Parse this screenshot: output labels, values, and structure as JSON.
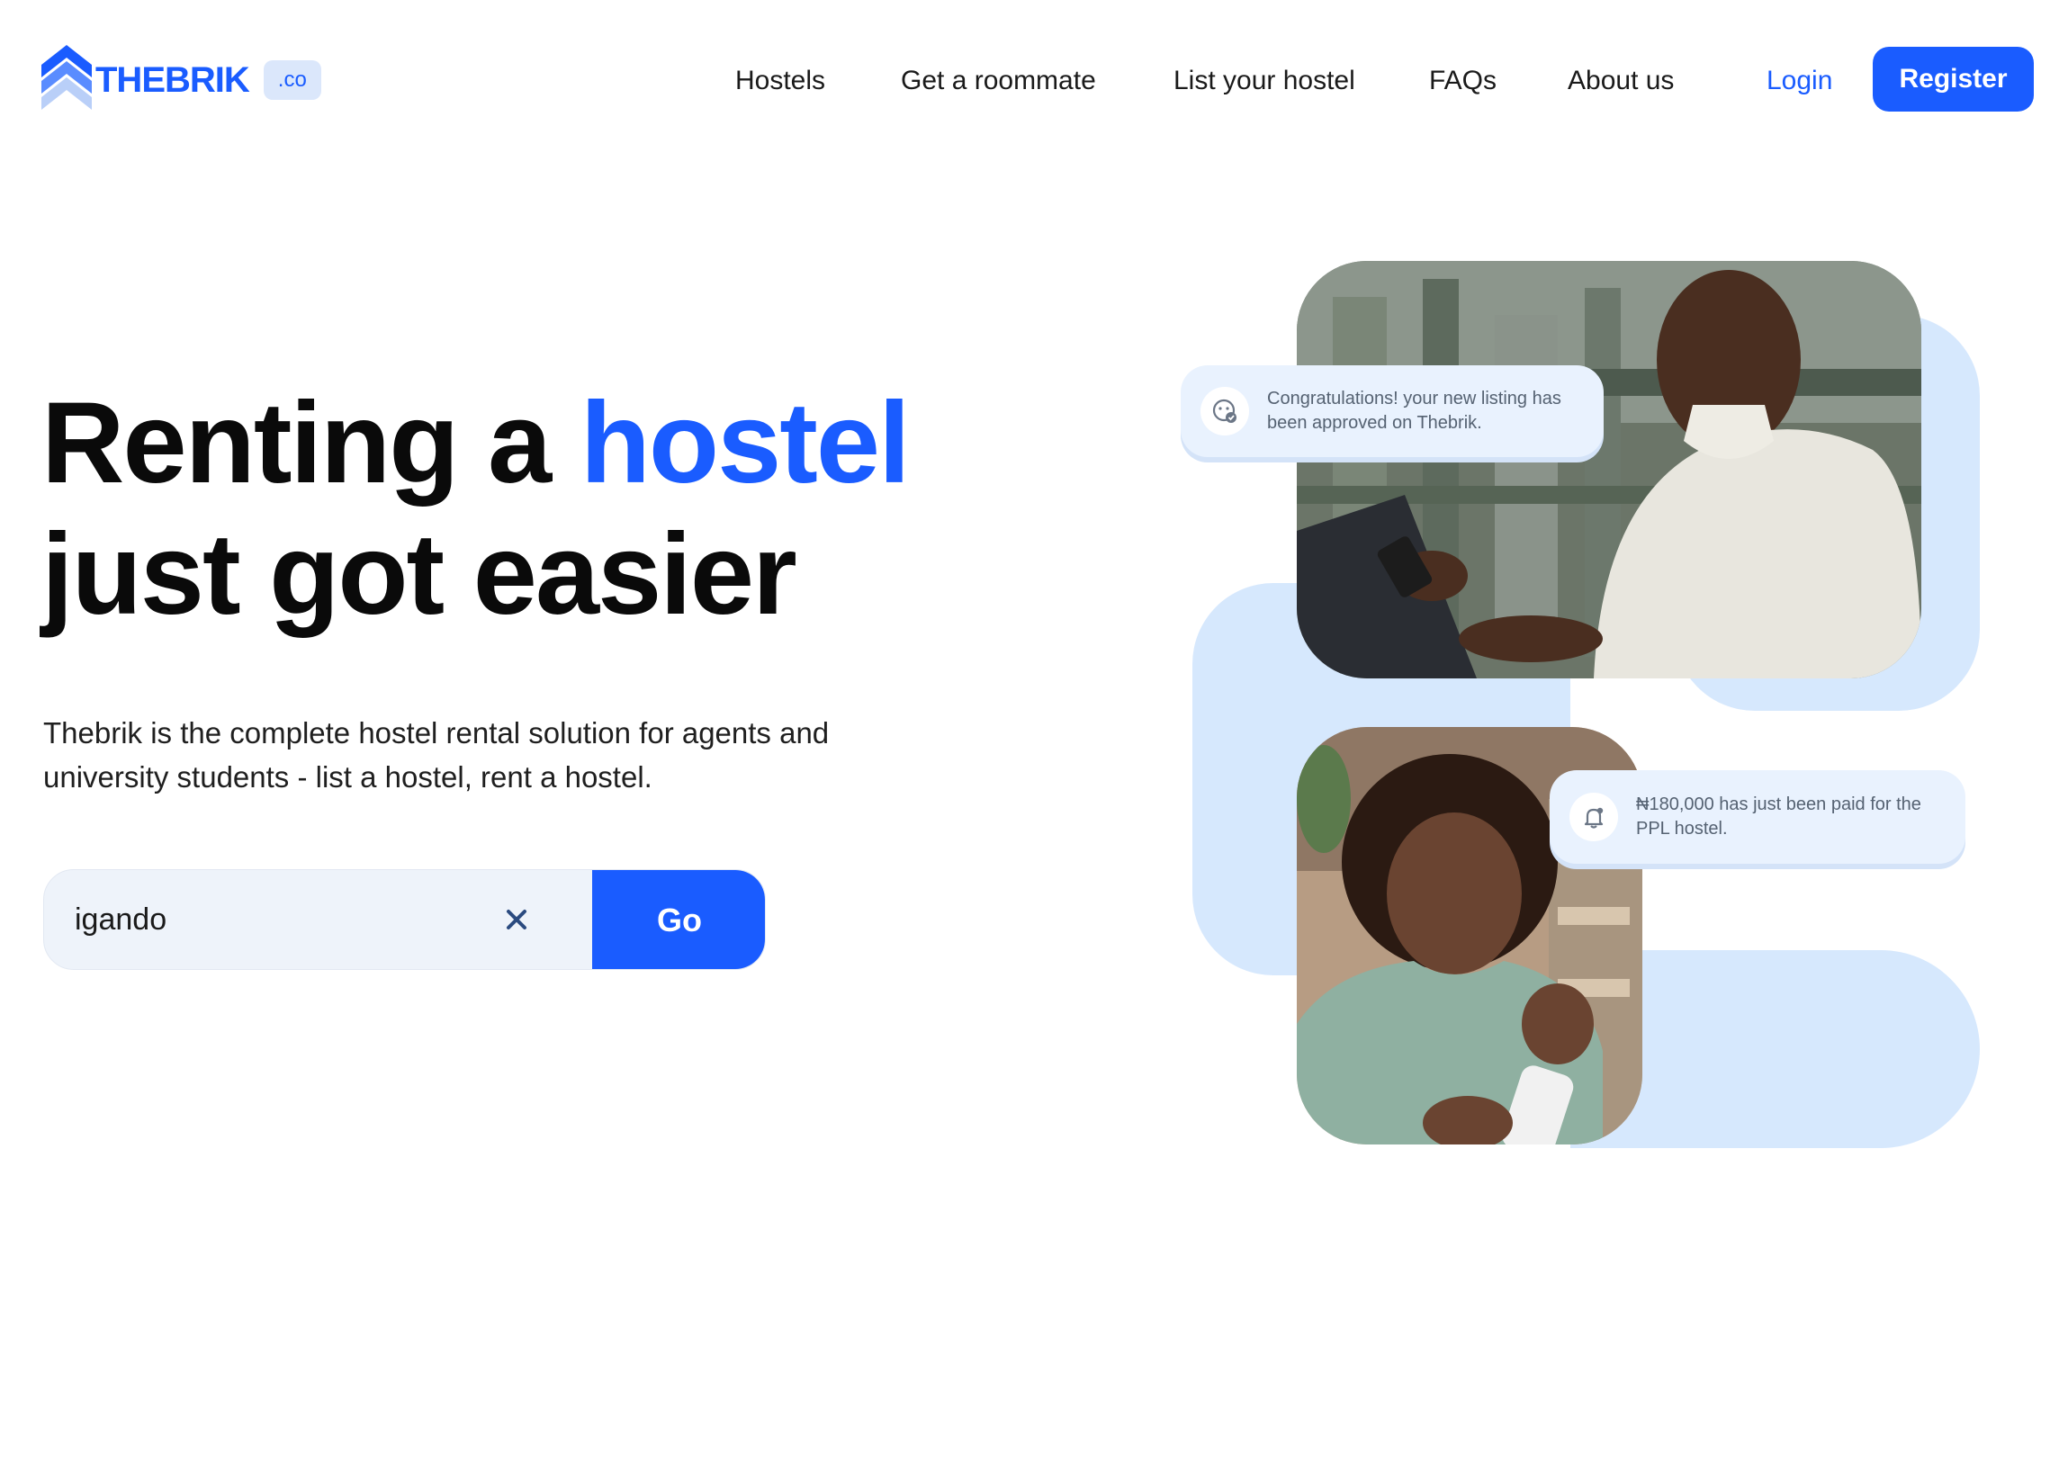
{
  "brand": {
    "name": "THEBRIK",
    "badge": ".co"
  },
  "nav": {
    "links": [
      "Hostels",
      "Get a roommate",
      "List your hostel",
      "FAQs",
      "About us"
    ],
    "login_label": "Login",
    "register_label": "Register"
  },
  "hero": {
    "headline_part1": "Renting a",
    "headline_accent": "hostel",
    "headline_part2": "just got easier",
    "subtext": "Thebrik is the complete hostel rental solution for agents and university students - list a hostel, rent a hostel."
  },
  "search": {
    "value": "igando",
    "go_label": "Go"
  },
  "notifications": [
    {
      "text": "Congratulations! your new listing has been approved on Thebrik.",
      "icon": "verified-badge-icon"
    },
    {
      "text": "₦180,000 has just been paid for the PPL hostel.",
      "icon": "bell-icon"
    }
  ],
  "colors": {
    "accent": "#1a5cff",
    "blob": "#d6e8fd",
    "search_bg": "#eef3fa"
  }
}
